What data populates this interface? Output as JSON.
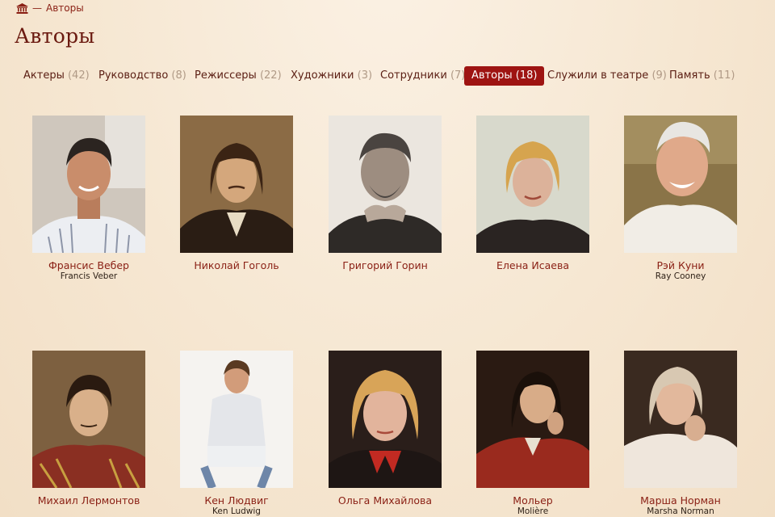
{
  "breadcrumb": {
    "home_icon": "theatre-building-icon",
    "separator": "—",
    "current": "Авторы"
  },
  "page_title": "Авторы",
  "tabs": [
    {
      "label": "Актеры",
      "count": "(42)",
      "active": false
    },
    {
      "label": "Руководство",
      "count": "(8)",
      "active": false
    },
    {
      "label": "Режиссеры",
      "count": "(22)",
      "active": false
    },
    {
      "label": "Художники",
      "count": "(3)",
      "active": false
    },
    {
      "label": "Сотрудники",
      "count": "(7)",
      "active": false
    },
    {
      "label": "Авторы",
      "count": "(18)",
      "active": true
    },
    {
      "label": "Служили в театре",
      "count": "(9)",
      "active": false
    },
    {
      "label": "Память",
      "count": "(11)",
      "active": false
    }
  ],
  "authors": [
    {
      "name": "Франсис Вебер",
      "original": "Francis Veber",
      "photo_tone": "color"
    },
    {
      "name": "Николай Гоголь",
      "original": "",
      "photo_tone": "painting"
    },
    {
      "name": "Григорий Горин",
      "original": "",
      "photo_tone": "bw"
    },
    {
      "name": "Елена Исаева",
      "original": "",
      "photo_tone": "color"
    },
    {
      "name": "Рэй Куни",
      "original": "Ray Cooney",
      "photo_tone": "color"
    },
    {
      "name": "Михаил Лермонтов",
      "original": "",
      "photo_tone": "painting"
    },
    {
      "name": "Кен Людвиг",
      "original": "Ken Ludwig",
      "photo_tone": "color"
    },
    {
      "name": "Ольга Михайлова",
      "original": "",
      "photo_tone": "color"
    },
    {
      "name": "Мольер",
      "original": "Molière",
      "photo_tone": "painting"
    },
    {
      "name": "Марша Норман",
      "original": "Marsha Norman",
      "photo_tone": "sepia"
    }
  ],
  "colors": {
    "accent": "#9e1412",
    "link": "#8a1f14",
    "title": "#6b1a10",
    "background": "#f6e7d2"
  }
}
